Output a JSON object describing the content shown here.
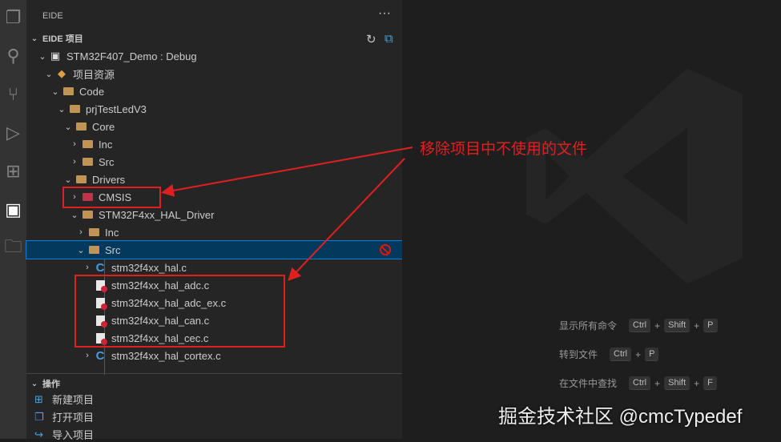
{
  "activity": [
    "files-icon",
    "search-icon",
    "source-control-icon",
    "run-debug-icon",
    "extensions-icon",
    "eide-chip-icon",
    "folder-icon"
  ],
  "sidebar": {
    "title": "EIDE",
    "more": "···",
    "section": "EIDE 项目"
  },
  "tree": [
    {
      "label": "STM32F407_Demo : Debug",
      "depth": 0,
      "chev": "open",
      "icon": "project"
    },
    {
      "label": "项目资源",
      "depth": 1,
      "chev": "open",
      "icon": "resource"
    },
    {
      "label": "Code",
      "depth": 2,
      "chev": "open",
      "icon": "folder"
    },
    {
      "label": "prjTestLedV3",
      "depth": 3,
      "chev": "open",
      "icon": "folder"
    },
    {
      "label": "Core",
      "depth": 4,
      "chev": "open",
      "icon": "folder"
    },
    {
      "label": "Inc",
      "depth": 5,
      "chev": "closed",
      "icon": "folder"
    },
    {
      "label": "Src",
      "depth": 5,
      "chev": "closed",
      "icon": "folder"
    },
    {
      "label": "Drivers",
      "depth": 4,
      "chev": "open",
      "icon": "folder"
    },
    {
      "label": "CMSIS",
      "depth": 5,
      "chev": "closed",
      "icon": "folder-excluded"
    },
    {
      "label": "STM32F4xx_HAL_Driver",
      "depth": 5,
      "chev": "open",
      "icon": "folder"
    },
    {
      "label": "Inc",
      "depth": 6,
      "chev": "closed",
      "icon": "folder"
    },
    {
      "label": "Src",
      "depth": 6,
      "chev": "open",
      "icon": "folder",
      "selected": true
    },
    {
      "label": "stm32f4xx_hal.c",
      "depth": 7,
      "chev": "closed",
      "icon": "c"
    },
    {
      "label": "stm32f4xx_hal_adc.c",
      "depth": 7,
      "chev": "none",
      "icon": "file-excluded"
    },
    {
      "label": "stm32f4xx_hal_adc_ex.c",
      "depth": 7,
      "chev": "none",
      "icon": "file-excluded"
    },
    {
      "label": "stm32f4xx_hal_can.c",
      "depth": 7,
      "chev": "none",
      "icon": "file-excluded"
    },
    {
      "label": "stm32f4xx_hal_cec.c",
      "depth": 7,
      "chev": "none",
      "icon": "file-excluded"
    },
    {
      "label": "stm32f4xx_hal_cortex.c",
      "depth": 7,
      "chev": "closed",
      "icon": "c"
    }
  ],
  "ops": {
    "title": "操作",
    "items": [
      "新建项目",
      "打开项目",
      "导入项目"
    ]
  },
  "shortcuts": [
    {
      "label": "显示所有命令",
      "keys": [
        "Ctrl",
        "Shift",
        "P"
      ]
    },
    {
      "label": "转到文件",
      "keys": [
        "Ctrl",
        "P"
      ]
    },
    {
      "label": "在文件中查找",
      "keys": [
        "Ctrl",
        "Shift",
        "F"
      ]
    }
  ],
  "annotation": "移除项目中不使用的文件",
  "watermark": "掘金技术社区 @cmcTypedef",
  "colors": {
    "annotation": "#e02020",
    "selection": "#04395e",
    "folder": "#c09553"
  }
}
